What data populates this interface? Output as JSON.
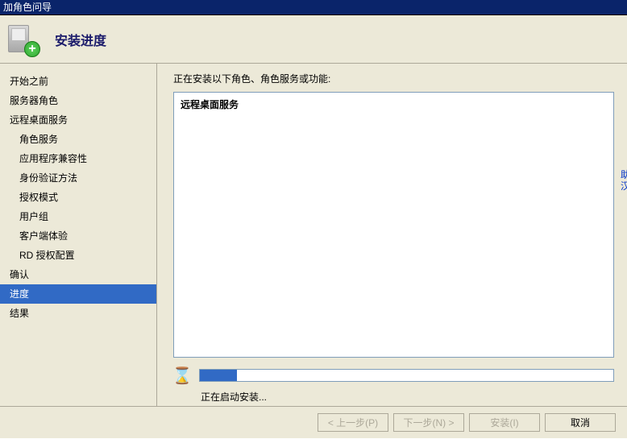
{
  "titlebar": {
    "text": "加角色问导"
  },
  "header": {
    "title": "安装进度"
  },
  "sidebar": {
    "items": [
      {
        "label": "开始之前",
        "sub": false,
        "active": false
      },
      {
        "label": "服务器角色",
        "sub": false,
        "active": false
      },
      {
        "label": "远程桌面服务",
        "sub": false,
        "active": false
      },
      {
        "label": "角色服务",
        "sub": true,
        "active": false
      },
      {
        "label": "应用程序兼容性",
        "sub": true,
        "active": false
      },
      {
        "label": "身份验证方法",
        "sub": true,
        "active": false
      },
      {
        "label": "授权模式",
        "sub": true,
        "active": false
      },
      {
        "label": "用户组",
        "sub": true,
        "active": false
      },
      {
        "label": "客户端体验",
        "sub": true,
        "active": false
      },
      {
        "label": "RD 授权配置",
        "sub": true,
        "active": false
      },
      {
        "label": "确认",
        "sub": false,
        "active": false
      },
      {
        "label": "进度",
        "sub": false,
        "active": true
      },
      {
        "label": "结果",
        "sub": false,
        "active": false
      }
    ]
  },
  "content": {
    "installing_label": "正在安装以下角色、角色服务或功能:",
    "install_items": [
      "远程桌面服务"
    ],
    "progress_percent": 9,
    "status_text": "正在启动安装..."
  },
  "footer": {
    "prev": "< 上一步(P)",
    "next": "下一步(N) >",
    "install": "安装(I)",
    "cancel": "取消"
  },
  "edge_text": "助 汉"
}
